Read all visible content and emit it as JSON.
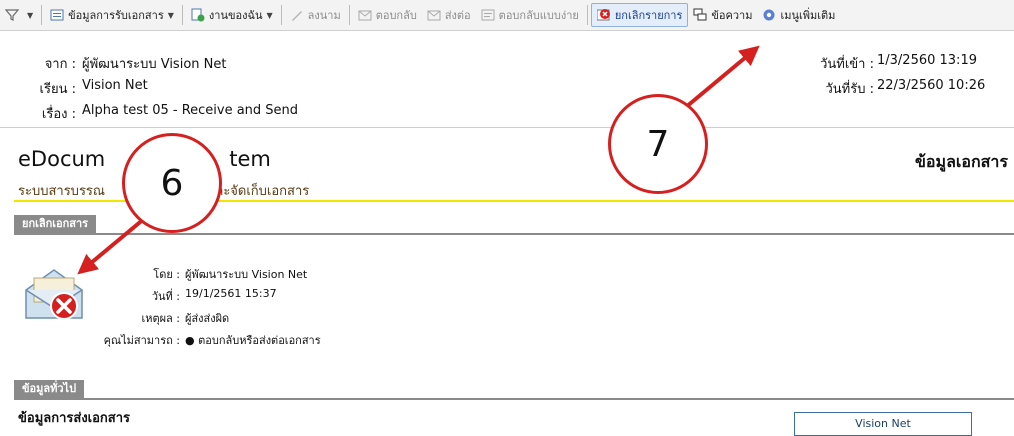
{
  "toolbar": {
    "items": [
      {
        "label": "ข้อมูลการรับเอกสาร"
      },
      {
        "label": "งานของฉัน"
      },
      {
        "label": "ลงนาม"
      },
      {
        "label": "ตอบกลับ"
      },
      {
        "label": "ส่งต่อ"
      },
      {
        "label": "ตอบกลับแบบง่าย"
      },
      {
        "label": "ยกเลิกรายการ"
      },
      {
        "label": "ข้อความ"
      },
      {
        "label": "เมนูเพิ่มเติม"
      }
    ]
  },
  "header": {
    "from_label": "จาก :",
    "from_value": "ผู้พัฒนาระบบ Vision Net",
    "to_label": "เรียน :",
    "to_value": "Vision Net",
    "subject_label": "เรื่อง :",
    "subject_value": "Alpha test 05 - Receive and Send",
    "date_in_label": "วันที่เข้า :",
    "date_in_value": "1/3/2560 13:19",
    "date_recv_label": "วันที่รับ :",
    "date_recv_value": "22/3/2560 10:26"
  },
  "app": {
    "title": "eDocum",
    "title_tail": "tem",
    "subtitle": "ระบบสารบรรณ",
    "subtitle_tail": "และจัดเก็บเอกสาร",
    "right_title": "ข้อมูลเอกสาร"
  },
  "cancel_section": {
    "tab_label": "ยกเลิกเอกสาร",
    "by_label": "โดย :",
    "by_value": "ผู้พัฒนาระบบ Vision Net",
    "date_label": "วันที่ :",
    "date_value": "19/1/2561 15:37",
    "reason_label": "เหตุผล :",
    "reason_value": "ผู้ส่งส่งผิด",
    "cannot_label": "คุณไม่สามารถ :",
    "cannot_value": "●  ตอบกลับหรือส่งต่อเอกสาร"
  },
  "general_section": {
    "tab_label": "ข้อมูลทั่วไป",
    "subheading": "ข้อมูลการส่งเอกสาร",
    "recipient_box": "Vision Net"
  },
  "annotations": {
    "circle_6": "6",
    "circle_7": "7",
    "color": "#d62020"
  }
}
